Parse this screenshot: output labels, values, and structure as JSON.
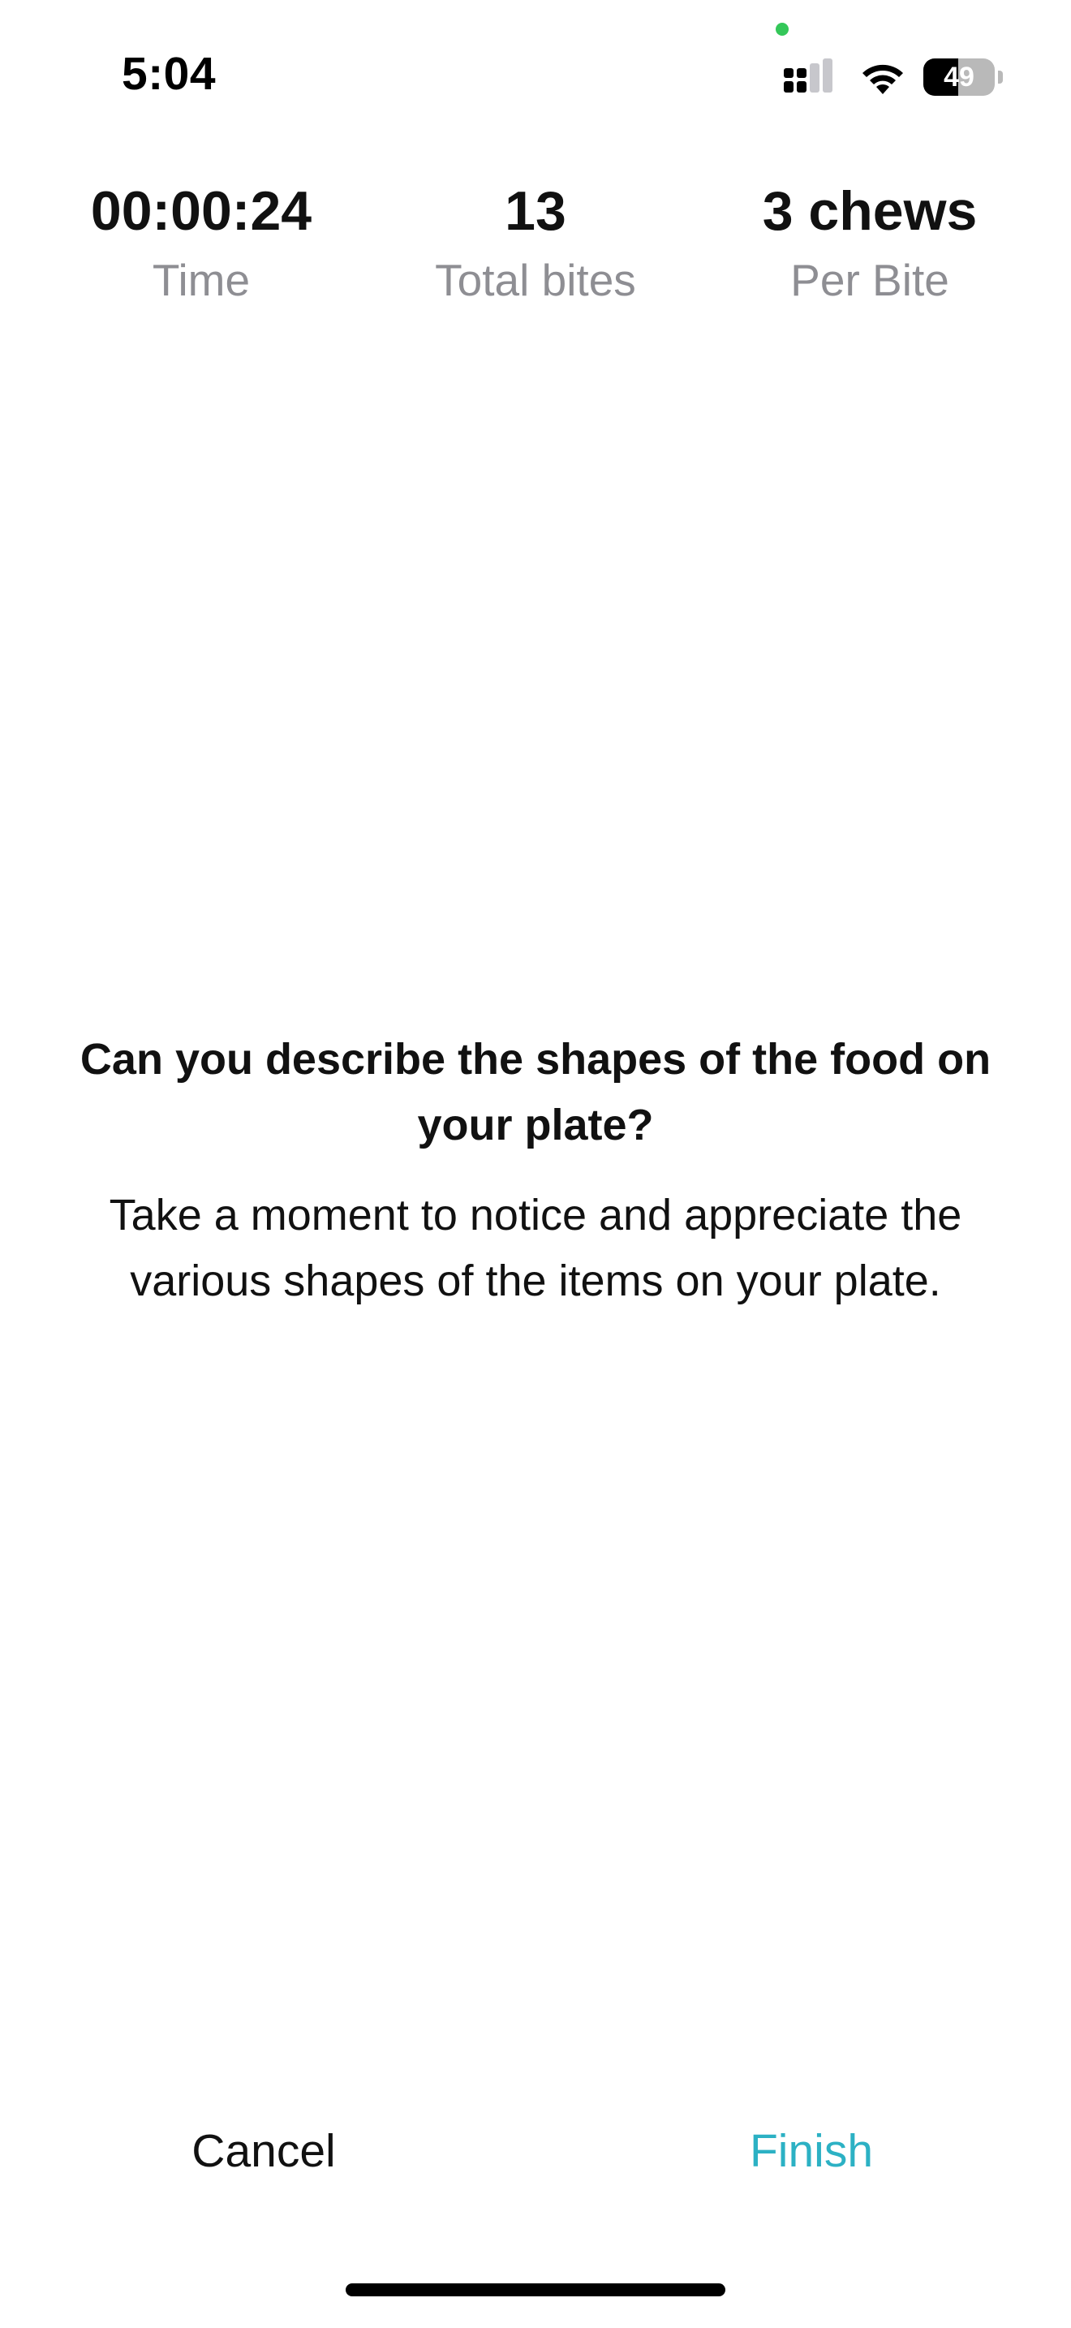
{
  "status_bar": {
    "time": "5:04",
    "battery_level": "49",
    "battery_fraction": 0.49,
    "privacy_indicator_color": "#34c759"
  },
  "stats": [
    {
      "value": "00:00:24",
      "label": "Time"
    },
    {
      "value": "13",
      "label": "Total bites"
    },
    {
      "value": "3 chews",
      "label": "Per Bite"
    }
  ],
  "prompt": {
    "question": "Can you describe the shapes of the food on your plate?",
    "body": "Take a moment to notice and appreciate the various shapes of the items on your plate."
  },
  "actions": {
    "cancel_label": "Cancel",
    "finish_label": "Finish",
    "accent_color": "#2cb1c4"
  }
}
